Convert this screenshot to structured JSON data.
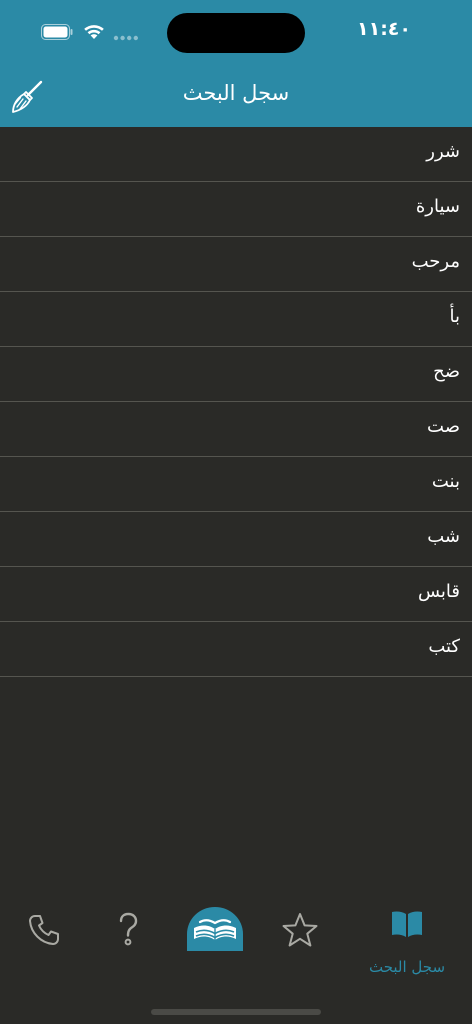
{
  "status_bar": {
    "time": "١١:٤٠"
  },
  "header": {
    "title": "سجل البحث",
    "clear_icon": "broom-icon"
  },
  "history": [
    "شرر",
    "سيارة",
    "مرحب",
    "بأ",
    "ضح",
    "صت",
    "بنت",
    "شب",
    "قابس",
    "كتب"
  ],
  "tab_bar": {
    "tabs": [
      {
        "icon": "phone-icon"
      },
      {
        "icon": "question-icon"
      },
      {
        "icon": "open-book-dome-icon"
      },
      {
        "icon": "star-icon"
      },
      {
        "icon": "book-icon",
        "label": "سجل البحث",
        "selected": true
      }
    ]
  },
  "colors": {
    "accent": "#2b8aa6",
    "background": "#2a2a27",
    "divider": "#55554f",
    "text": "#ffffff"
  }
}
